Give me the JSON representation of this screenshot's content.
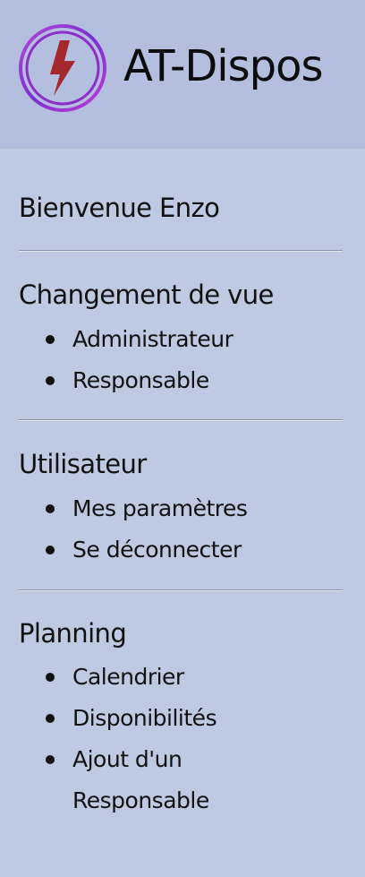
{
  "app": {
    "title": "AT-Dispos",
    "logo_icon": "lightning-bolt-icon",
    "colors": {
      "header_bg": "#b4bfdf",
      "body_bg": "#bec9e2",
      "logo_ring": "#8b2fc9",
      "logo_bolt": "#a52a2a"
    }
  },
  "welcome": "Bienvenue Enzo",
  "sections": [
    {
      "title": "Changement de vue",
      "items": [
        "Administrateur",
        "Responsable"
      ]
    },
    {
      "title": "Utilisateur",
      "items": [
        "Mes paramètres",
        "Se déconnecter"
      ]
    },
    {
      "title": "Planning",
      "items": [
        "Calendrier",
        "Disponibilités",
        "Ajout d'un Responsable"
      ]
    }
  ]
}
